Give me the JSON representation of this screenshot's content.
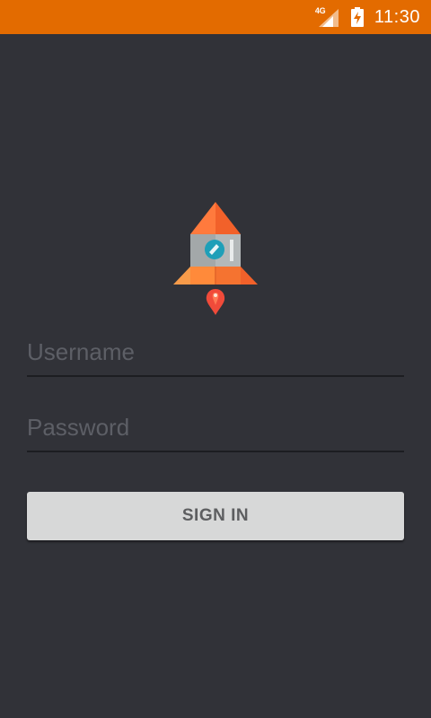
{
  "status_bar": {
    "network_label": "4G",
    "time": "11:30",
    "background_color": "#e36b00",
    "icons": [
      "signal-icon",
      "battery-charging-icon"
    ]
  },
  "logo": {
    "icon": "rocket-icon",
    "colors": [
      "#ff7a3d",
      "#f2612a",
      "#a0a6a8",
      "#1e9fb8",
      "#f04b3a"
    ]
  },
  "form": {
    "username": {
      "placeholder": "Username",
      "value": ""
    },
    "password": {
      "placeholder": "Password",
      "value": ""
    },
    "signin_label": "SIGN IN"
  },
  "theme": {
    "background": "#313238",
    "button_background": "#d7d8d8"
  }
}
